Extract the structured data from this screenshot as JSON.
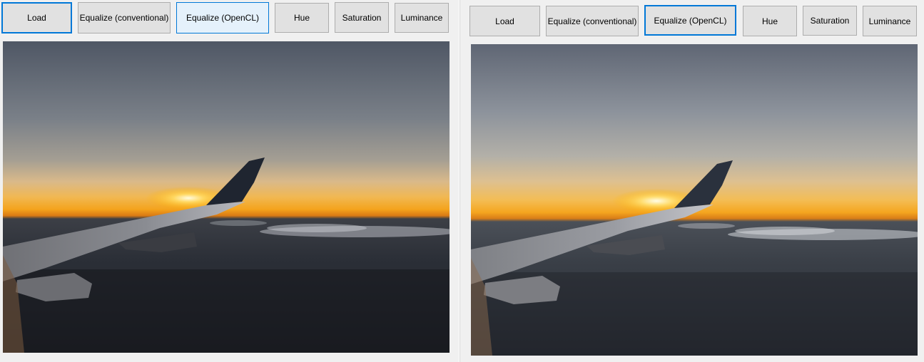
{
  "left_pane": {
    "buttons": {
      "load": "Load",
      "equalize_conventional": "Equalize (conventional)",
      "equalize_opencl": "Equalize (OpenCL)",
      "hue": "Hue",
      "saturation": "Saturation",
      "luminance": "Luminance"
    },
    "image": {
      "icon": "sunset-airplane-wing-photo",
      "variant": "original"
    }
  },
  "right_pane": {
    "buttons": {
      "load": "Load",
      "equalize_conventional": "Equalize (conventional)",
      "equalize_opencl": "Equalize (OpenCL)",
      "hue": "Hue",
      "saturation": "Saturation",
      "luminance": "Luminance"
    },
    "image": {
      "icon": "sunset-airplane-wing-photo",
      "variant": "equalized"
    }
  },
  "colors": {
    "focus_border": "#0078d7",
    "button_face": "#e1e1e1",
    "hover_face": "#e5f1fb",
    "window_bg": "#f0f0f0"
  }
}
